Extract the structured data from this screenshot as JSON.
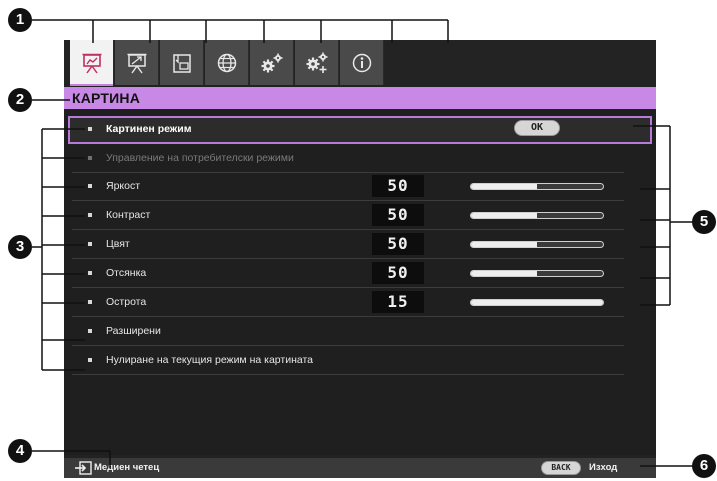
{
  "tabs": [
    {
      "icon": "picture-icon",
      "active": true
    },
    {
      "icon": "display-icon",
      "active": false
    },
    {
      "icon": "input-icon",
      "active": false
    },
    {
      "icon": "globe-icon",
      "active": false
    },
    {
      "icon": "settings-icon",
      "active": false
    },
    {
      "icon": "advanced-settings-icon",
      "active": false
    },
    {
      "icon": "info-icon",
      "active": false
    }
  ],
  "header": {
    "title": "КАРТИНА"
  },
  "menu": {
    "items": [
      {
        "label": "Картинен режим",
        "control": "OK"
      },
      {
        "label": "Управление на потребителски режими"
      },
      {
        "label": "Яркост",
        "value": "50",
        "level": 0.5
      },
      {
        "label": "Контраст",
        "value": "50",
        "level": 0.5
      },
      {
        "label": "Цвят",
        "value": "50",
        "level": 0.5
      },
      {
        "label": "Отсянка",
        "value": "50",
        "level": 0.5
      },
      {
        "label": "Острота",
        "value": "15",
        "level": 1.0
      },
      {
        "label": "Разширени"
      },
      {
        "label": "Нулиране на текущия режим на картината"
      }
    ]
  },
  "footer": {
    "source_label": "Медиен четец",
    "back_button": "BACK",
    "exit_label": "Изход"
  },
  "callouts": [
    "1",
    "2",
    "3",
    "4",
    "5",
    "6"
  ],
  "colors": {
    "accent": "#c888e6",
    "selection_border": "#b77ad8",
    "background": "#1f1f1f"
  }
}
